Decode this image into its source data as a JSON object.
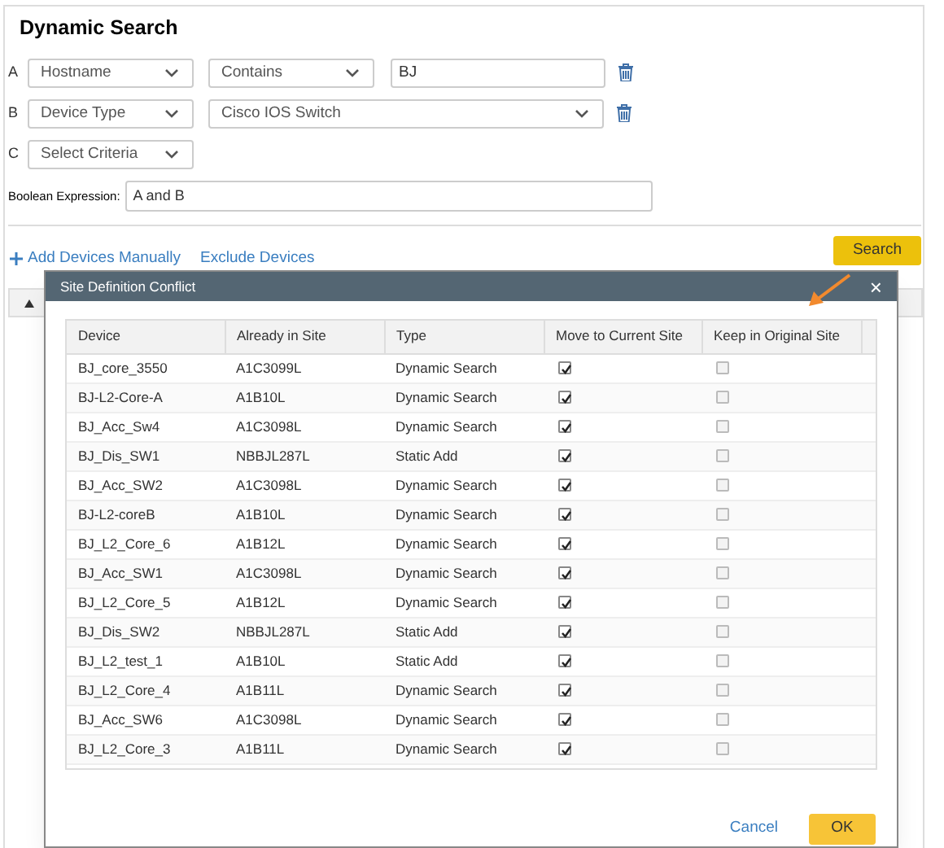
{
  "search_panel": {
    "title": "Dynamic Search",
    "criteria": [
      {
        "letter": "A",
        "kind": "text",
        "field": "Hostname",
        "operator": "Contains",
        "value": "BJ"
      },
      {
        "letter": "B",
        "kind": "select",
        "field": "Device Type",
        "value": "Cisco IOS Switch"
      },
      {
        "letter": "C",
        "kind": "empty",
        "field": "Select Criteria"
      }
    ],
    "boolean_label": "Boolean Expression:",
    "boolean_value": "A and B",
    "links": [
      "Add Devices Manually",
      "Exclude Devices"
    ],
    "search_button": "Search"
  },
  "dialog": {
    "title": "Site Definition Conflict",
    "close": "×",
    "columns": [
      "Device",
      "Already in Site",
      "Type",
      "Move to Current Site",
      "Keep in Original Site"
    ],
    "rows": [
      {
        "device": "BJ_core_3550",
        "site": "A1C3099L",
        "type": "Dynamic Search",
        "move": true,
        "keep": false
      },
      {
        "device": "BJ-L2-Core-A",
        "site": "A1B10L",
        "type": "Dynamic Search",
        "move": true,
        "keep": false
      },
      {
        "device": "BJ_Acc_Sw4",
        "site": "A1C3098L",
        "type": "Dynamic Search",
        "move": true,
        "keep": false
      },
      {
        "device": "BJ_Dis_SW1",
        "site": "NBBJL287L",
        "type": "Static Add",
        "move": true,
        "keep": false
      },
      {
        "device": "BJ_Acc_SW2",
        "site": "A1C3098L",
        "type": "Dynamic Search",
        "move": true,
        "keep": false
      },
      {
        "device": "BJ-L2-coreB",
        "site": "A1B10L",
        "type": "Dynamic Search",
        "move": true,
        "keep": false
      },
      {
        "device": "BJ_L2_Core_6",
        "site": "A1B12L",
        "type": "Dynamic Search",
        "move": true,
        "keep": false
      },
      {
        "device": "BJ_Acc_SW1",
        "site": "A1C3098L",
        "type": "Dynamic Search",
        "move": true,
        "keep": false
      },
      {
        "device": "BJ_L2_Core_5",
        "site": "A1B12L",
        "type": "Dynamic Search",
        "move": true,
        "keep": false
      },
      {
        "device": "BJ_Dis_SW2",
        "site": "NBBJL287L",
        "type": "Static Add",
        "move": true,
        "keep": false
      },
      {
        "device": "BJ_L2_test_1",
        "site": "A1B10L",
        "type": "Static Add",
        "move": true,
        "keep": false
      },
      {
        "device": "BJ_L2_Core_4",
        "site": "A1B11L",
        "type": "Dynamic Search",
        "move": true,
        "keep": false
      },
      {
        "device": "BJ_Acc_SW6",
        "site": "A1C3098L",
        "type": "Dynamic Search",
        "move": true,
        "keep": false
      },
      {
        "device": "BJ_L2_Core_3",
        "site": "A1B11L",
        "type": "Dynamic Search",
        "move": true,
        "keep": false
      }
    ],
    "buttons": {
      "cancel": "Cancel",
      "ok": "OK"
    }
  }
}
